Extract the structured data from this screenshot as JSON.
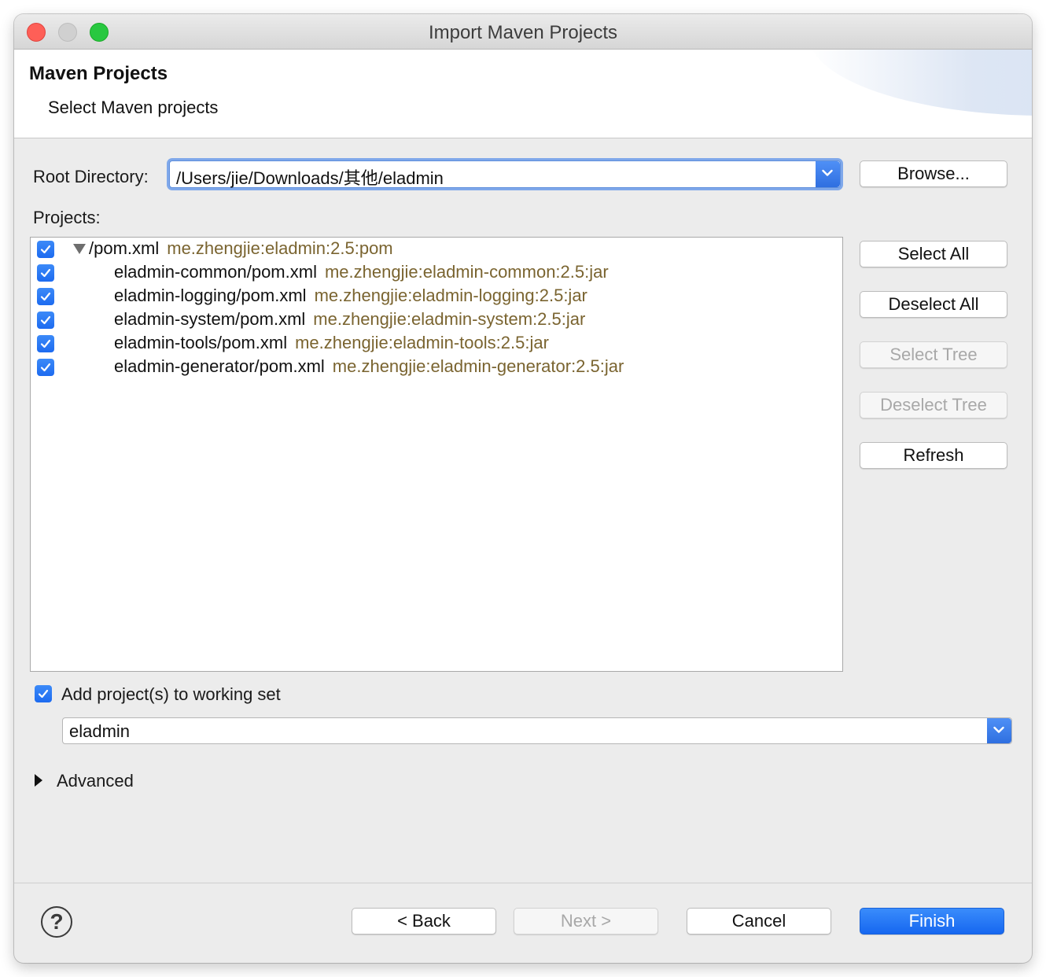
{
  "window": {
    "title": "Import Maven Projects"
  },
  "banner": {
    "title": "Maven Projects",
    "subtitle": "Select Maven projects"
  },
  "root_directory": {
    "label": "Root Directory:",
    "value": "/Users/jie/Downloads/其他/eladmin",
    "browse_label": "Browse..."
  },
  "projects": {
    "label": "Projects:",
    "items": [
      {
        "name": "/pom.xml",
        "gav": "me.zhengjie:eladmin:2.5:pom",
        "checked": true,
        "expanded": true
      },
      {
        "name": "eladmin-common/pom.xml",
        "gav": "me.zhengjie:eladmin-common:2.5:jar",
        "checked": true
      },
      {
        "name": "eladmin-logging/pom.xml",
        "gav": "me.zhengjie:eladmin-logging:2.5:jar",
        "checked": true
      },
      {
        "name": "eladmin-system/pom.xml",
        "gav": "me.zhengjie:eladmin-system:2.5:jar",
        "checked": true
      },
      {
        "name": "eladmin-tools/pom.xml",
        "gav": "me.zhengjie:eladmin-tools:2.5:jar",
        "checked": true
      },
      {
        "name": "eladmin-generator/pom.xml",
        "gav": "me.zhengjie:eladmin-generator:2.5:jar",
        "checked": true
      }
    ]
  },
  "side_buttons": {
    "select_all": "Select All",
    "deselect_all": "Deselect All",
    "select_tree": "Select Tree",
    "deselect_tree": "Deselect Tree",
    "refresh": "Refresh"
  },
  "working_set": {
    "checkbox_label": "Add project(s) to working set",
    "checked": true,
    "value": "eladmin"
  },
  "advanced": {
    "label": "Advanced"
  },
  "footer": {
    "help_symbol": "?",
    "back": "< Back",
    "next": "Next >",
    "cancel": "Cancel",
    "finish": "Finish"
  },
  "colors": {
    "accent": "#1d6bf0",
    "gav_text": "#7a6430"
  }
}
